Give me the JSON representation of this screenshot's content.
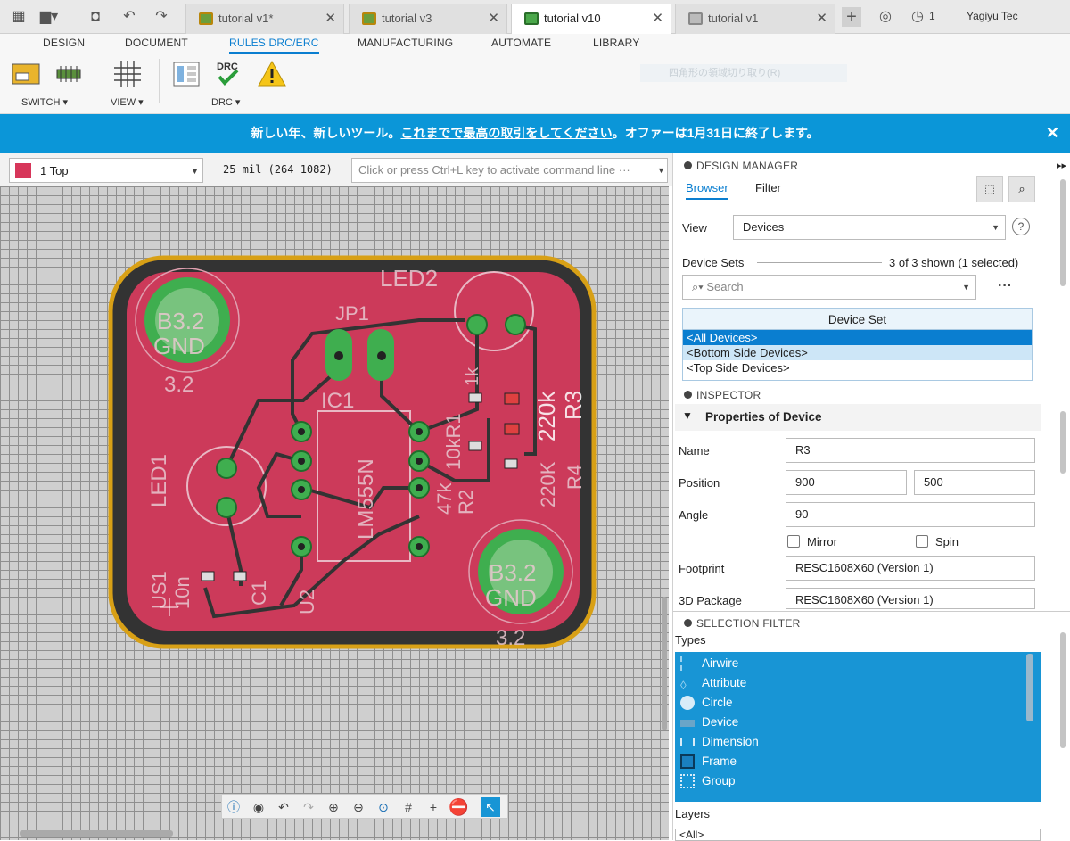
{
  "tabs": [
    {
      "label": "tutorial v1*",
      "active": false
    },
    {
      "label": "tutorial v3",
      "active": false
    },
    {
      "label": "tutorial v10",
      "active": true
    },
    {
      "label": "tutorial v1",
      "active": false
    }
  ],
  "notification_count": "1",
  "user_name": "Yagiyu Tec",
  "ribbon_tabs": [
    "DESIGN",
    "DOCUMENT",
    "RULES DRC/ERC",
    "MANUFACTURING",
    "AUTOMATE",
    "LIBRARY"
  ],
  "ribbon_groups": {
    "switch": "SWITCH ▾",
    "view": "VIEW ▾",
    "drc": "DRC ▾",
    "drc_icon_text": "DRC"
  },
  "faded_text": "四角形の領域切り取り(R)",
  "banner": {
    "text_before": "新しい年、新しいツール。",
    "link_text": "これまでで最高の取引をしてください",
    "text_after": "。オファーは1月31日に終了します。",
    "close": "✕"
  },
  "layer_select": {
    "value": "1 Top",
    "color": "#d7365a"
  },
  "grid_info": "25 mil (264 1082)",
  "command_placeholder": "Click or press Ctrl+L key to activate command line ···",
  "pcb": {
    "labels": [
      "LED2",
      "JP1",
      "B3.2",
      "GND",
      "3.2",
      "B3.2",
      "GND",
      "3.2",
      "IC1",
      "LM555N",
      "LED1",
      "220k",
      "R3",
      "220K",
      "R4",
      "10kR1",
      "47k",
      "R2",
      "1k",
      "10n",
      "C1",
      "U2",
      "US1"
    ],
    "board_color": "#cc3a5a",
    "outline_color": "#d8a016",
    "pad_color": "#3fae4f",
    "trace_color": "#333333"
  },
  "design_manager": {
    "title": "DESIGN MANAGER",
    "tabs": [
      "Browser",
      "Filter"
    ],
    "view_label": "View",
    "view_value": "Devices",
    "help": "?",
    "device_sets_label": "Device Sets",
    "device_sets_count": "3 of 3 shown (1 selected)",
    "search_placeholder": "Search",
    "more": "···",
    "list_header": "Device Set",
    "device_sets": [
      "<All Devices>",
      "<Bottom Side Devices>",
      "<Top Side Devices>"
    ]
  },
  "inspector": {
    "title": "INSPECTOR",
    "section": "Properties of Device",
    "name_label": "Name",
    "name_value": "R3",
    "position_label": "Position",
    "position_x": "900",
    "position_y": "500",
    "angle_label": "Angle",
    "angle_value": "90",
    "mirror_label": "Mirror",
    "spin_label": "Spin",
    "footprint_label": "Footprint",
    "footprint_value": "RESC1608X60 (Version 1)",
    "package_label": "3D Package",
    "package_value": "RESC1608X60 (Version 1)"
  },
  "selection_filter": {
    "title": "SELECTION FILTER",
    "types_label": "Types",
    "types": [
      "Airwire",
      "Attribute",
      "Circle",
      "Device",
      "Dimension",
      "Frame",
      "Group"
    ],
    "layers_label": "Layers",
    "layers_value": "<All>"
  }
}
